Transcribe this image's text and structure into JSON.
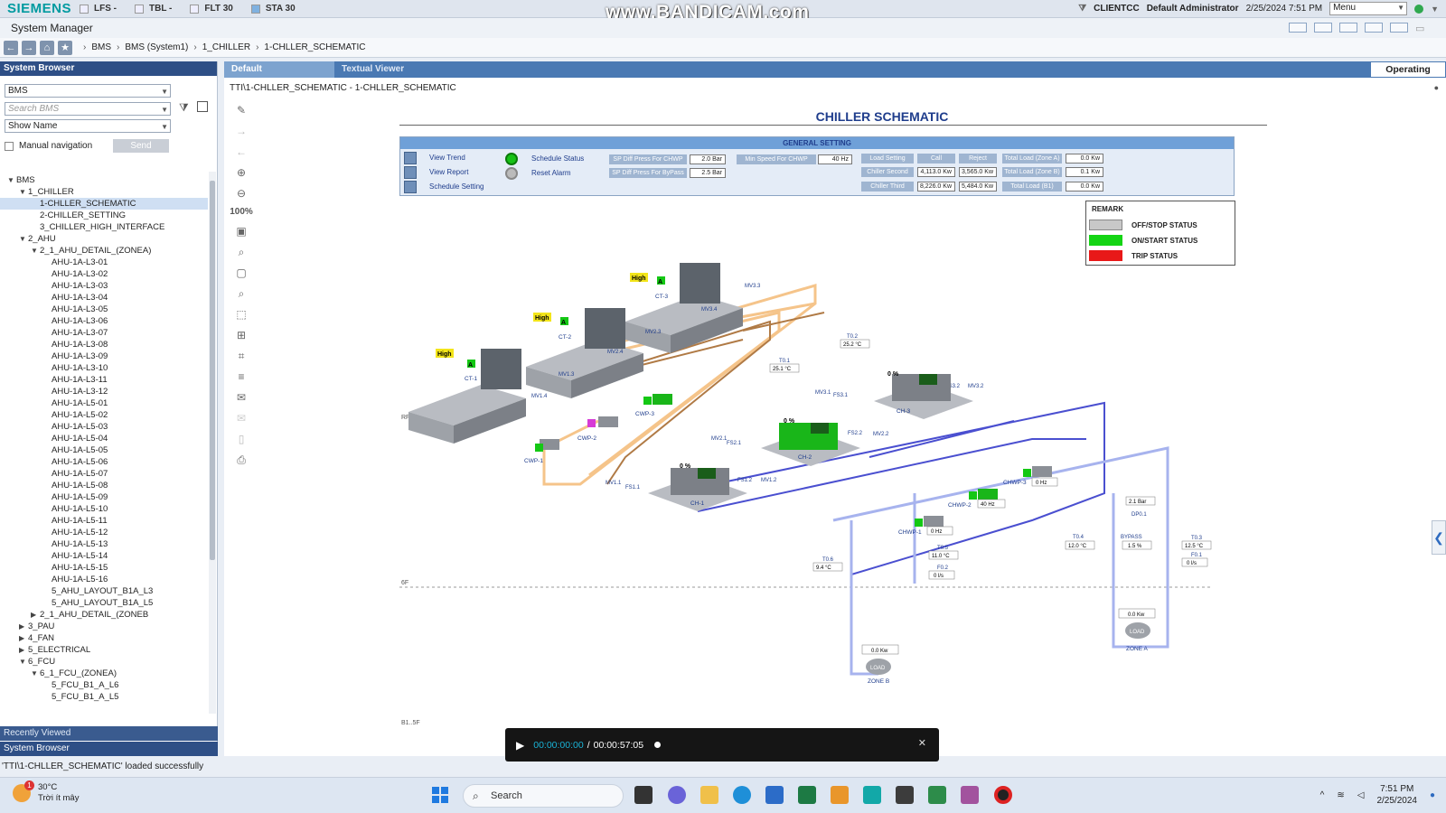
{
  "topbar": {
    "brand": "SIEMENS",
    "chips": [
      {
        "label": "LFS -"
      },
      {
        "label": "TBL -"
      },
      {
        "label": "FLT 30"
      },
      {
        "label": "STA 30"
      }
    ],
    "watermark": "www.BANDICAM.com",
    "client": "CLIENTCC",
    "user": "Default Administrator",
    "datetime": "2/25/2024 7:51 PM",
    "menu_label": "Menu"
  },
  "app": {
    "title": "System Manager"
  },
  "breadcrumb": [
    "BMS",
    "BMS (System1)",
    "1_CHILLER",
    "1-CHLLER_SCHEMATIC"
  ],
  "left_panel": {
    "header": "System Browser",
    "view_select": "BMS",
    "search_placeholder": "Search BMS",
    "name_select": "Show Name",
    "manual_nav_label": "Manual navigation",
    "send_label": "Send",
    "tree": [
      {
        "label": "BMS",
        "level": 0,
        "state": "open"
      },
      {
        "label": "1_CHILLER",
        "level": 1,
        "state": "open"
      },
      {
        "label": "1-CHLLER_SCHEMATIC",
        "level": 2,
        "state": "leaf",
        "selected": true
      },
      {
        "label": "2-CHILLER_SETTING",
        "level": 2,
        "state": "leaf"
      },
      {
        "label": "3_CHILLER_HIGH_INTERFACE",
        "level": 2,
        "state": "leaf"
      },
      {
        "label": "2_AHU",
        "level": 1,
        "state": "open"
      },
      {
        "label": "2_1_AHU_DETAIL_(ZONEA)",
        "level": 2,
        "state": "open"
      },
      {
        "label": "AHU-1A-L3-01",
        "level": 3,
        "state": "leaf"
      },
      {
        "label": "AHU-1A-L3-02",
        "level": 3,
        "state": "leaf"
      },
      {
        "label": "AHU-1A-L3-03",
        "level": 3,
        "state": "leaf"
      },
      {
        "label": "AHU-1A-L3-04",
        "level": 3,
        "state": "leaf"
      },
      {
        "label": "AHU-1A-L3-05",
        "level": 3,
        "state": "leaf"
      },
      {
        "label": "AHU-1A-L3-06",
        "level": 3,
        "state": "leaf"
      },
      {
        "label": "AHU-1A-L3-07",
        "level": 3,
        "state": "leaf"
      },
      {
        "label": "AHU-1A-L3-08",
        "level": 3,
        "state": "leaf"
      },
      {
        "label": "AHU-1A-L3-09",
        "level": 3,
        "state": "leaf"
      },
      {
        "label": "AHU-1A-L3-10",
        "level": 3,
        "state": "leaf"
      },
      {
        "label": "AHU-1A-L3-11",
        "level": 3,
        "state": "leaf"
      },
      {
        "label": "AHU-1A-L3-12",
        "level": 3,
        "state": "leaf"
      },
      {
        "label": "AHU-1A-L5-01",
        "level": 3,
        "state": "leaf"
      },
      {
        "label": "AHU-1A-L5-02",
        "level": 3,
        "state": "leaf"
      },
      {
        "label": "AHU-1A-L5-03",
        "level": 3,
        "state": "leaf"
      },
      {
        "label": "AHU-1A-L5-04",
        "level": 3,
        "state": "leaf"
      },
      {
        "label": "AHU-1A-L5-05",
        "level": 3,
        "state": "leaf"
      },
      {
        "label": "AHU-1A-L5-06",
        "level": 3,
        "state": "leaf"
      },
      {
        "label": "AHU-1A-L5-07",
        "level": 3,
        "state": "leaf"
      },
      {
        "label": "AHU-1A-L5-08",
        "level": 3,
        "state": "leaf"
      },
      {
        "label": "AHU-1A-L5-09",
        "level": 3,
        "state": "leaf"
      },
      {
        "label": "AHU-1A-L5-10",
        "level": 3,
        "state": "leaf"
      },
      {
        "label": "AHU-1A-L5-11",
        "level": 3,
        "state": "leaf"
      },
      {
        "label": "AHU-1A-L5-12",
        "level": 3,
        "state": "leaf"
      },
      {
        "label": "AHU-1A-L5-13",
        "level": 3,
        "state": "leaf"
      },
      {
        "label": "AHU-1A-L5-14",
        "level": 3,
        "state": "leaf"
      },
      {
        "label": "AHU-1A-L5-15",
        "level": 3,
        "state": "leaf"
      },
      {
        "label": "AHU-1A-L5-16",
        "level": 3,
        "state": "leaf"
      },
      {
        "label": "5_AHU_LAYOUT_B1A_L3",
        "level": 3,
        "state": "leaf"
      },
      {
        "label": "5_AHU_LAYOUT_B1A_L5",
        "level": 3,
        "state": "leaf"
      },
      {
        "label": "2_1_AHU_DETAIL_(ZONEB",
        "level": 2,
        "state": "closed"
      },
      {
        "label": "3_PAU",
        "level": 1,
        "state": "closed"
      },
      {
        "label": "4_FAN",
        "level": 1,
        "state": "closed"
      },
      {
        "label": "5_ELECTRICAL",
        "level": 1,
        "state": "closed"
      },
      {
        "label": "6_FCU",
        "level": 1,
        "state": "open"
      },
      {
        "label": "6_1_FCU_(ZONEA)",
        "level": 2,
        "state": "open"
      },
      {
        "label": "5_FCU_B1_A_L6",
        "level": 3,
        "state": "leaf"
      },
      {
        "label": "5_FCU_B1_A_L5",
        "level": 3,
        "state": "leaf"
      }
    ],
    "recently_viewed": "Recently Viewed",
    "system_browser_tab": "System Browser"
  },
  "main": {
    "tabs": [
      "Default",
      "Textual Viewer"
    ],
    "operating": "Operating",
    "path": "TTI\\1-CHLLER_SCHEMATIC   -   1-CHLLER_SCHEMATIC",
    "zoom": "100%",
    "title": "CHILLER SCHEMATIC"
  },
  "general_setting": {
    "header": "GENERAL SETTING",
    "links": [
      "View Trend",
      "View Report",
      "Schedule Setting"
    ],
    "status": [
      "Schedule Status",
      "Reset Alarm"
    ],
    "sp_chwp_label": "SP Diff Press For CHWP",
    "sp_chwp_value": "2.0 Bar",
    "sp_bypass_label": "SP Diff Press For ByPass",
    "sp_bypass_value": "2.5 Bar",
    "min_speed_label": "Min Speed For CHWP",
    "min_speed_value": "40 Hz",
    "load_setting_label": "Load Setting",
    "call_label": "Call",
    "reject_label": "Reject",
    "chiller_second_label": "Chiller Second",
    "chiller_second_call": "4,113.0 Kw",
    "chiller_second_reject": "3,565.0 Kw",
    "chiller_third_label": "Chiller Third",
    "chiller_third_call": "8,226.0 Kw",
    "chiller_third_reject": "5,484.0 Kw",
    "total_a_label": "Total Load (Zone A)",
    "total_a_value": "0.0 Kw",
    "total_b_label": "Total Load (Zone B)",
    "total_b_value": "0.1 Kw",
    "total_b1_label": "Total Load (B1)",
    "total_b1_value": "0.0 Kw"
  },
  "remark": {
    "title": "REMARK",
    "items": [
      {
        "label": "OFF/STOP STATUS",
        "color": "#c8c8c8"
      },
      {
        "label": "ON/START STATUS",
        "color": "#14d414"
      },
      {
        "label": "TRIP STATUS",
        "color": "#e81818"
      }
    ]
  },
  "diagram": {
    "floors": [
      "RF",
      "6F",
      "B1..5F"
    ],
    "towers": [
      {
        "name": "CT-1",
        "mode": "High",
        "status": "A"
      },
      {
        "name": "CT-2",
        "mode": "High",
        "status": "A"
      },
      {
        "name": "CT-3",
        "mode": "High",
        "status": "A"
      }
    ],
    "valves": [
      "MV3.3",
      "MV3.4",
      "MV2.3",
      "MV2.4",
      "MV1.3",
      "MV1.4",
      "MV3.1",
      "FS3.1",
      "FS3.2",
      "MV3.2",
      "MV2.1",
      "FS2.1",
      "FS2.2",
      "MV2.2",
      "MV1.1",
      "FS1.1",
      "FS1.2",
      "MV1.2"
    ],
    "pumps": [
      "CWP-1",
      "CWP-2",
      "CWP-3"
    ],
    "chillers": [
      {
        "name": "CH-1",
        "load": "0 %"
      },
      {
        "name": "CH-2",
        "load": "0 %"
      },
      {
        "name": "CH-3",
        "load": "0 %"
      }
    ],
    "chw_pumps": [
      {
        "name": "CHWP-1",
        "speed": "0 Hz"
      },
      {
        "name": "CHWP-2",
        "speed": "40 Hz"
      },
      {
        "name": "CHWP-3",
        "speed": "0 Hz"
      }
    ],
    "sensors": [
      {
        "name": "T0.2",
        "value": "25.2 °C"
      },
      {
        "name": "T0.1",
        "value": "25.1 °C"
      },
      {
        "name": "T0.6",
        "value": "9.4 °C"
      },
      {
        "name": "T0.5",
        "value": "11.0 °C"
      },
      {
        "name": "F0.2",
        "value": "0 l/s"
      },
      {
        "name": "T0.4",
        "value": "12.0 °C"
      },
      {
        "name": "T0.3",
        "value": "12.5 °C"
      },
      {
        "name": "F0.1",
        "value": "0 l/s"
      }
    ],
    "dp": {
      "name": "DP0.1",
      "value": "2.1 Bar"
    },
    "bypass": {
      "name": "BYPASS",
      "value": "1.5 %"
    },
    "zone_a": {
      "name": "ZONE A",
      "value": "0.0 Kw",
      "load": "LOAD"
    },
    "zone_b": {
      "name": "ZONE B",
      "value": "0.0 Kw",
      "load": "LOAD"
    }
  },
  "video": {
    "elapsed": "00:00:00:00",
    "separator": "/",
    "total": "00:00:57:05"
  },
  "status_bar": "'TTI\\1-CHLLER_SCHEMATIC' loaded successfully",
  "taskbar": {
    "weather_temp": "30°C",
    "weather_desc": "Trời ít mây",
    "weather_badge": "1",
    "search": "Search",
    "time": "7:51 PM",
    "date": "2/25/2024"
  }
}
